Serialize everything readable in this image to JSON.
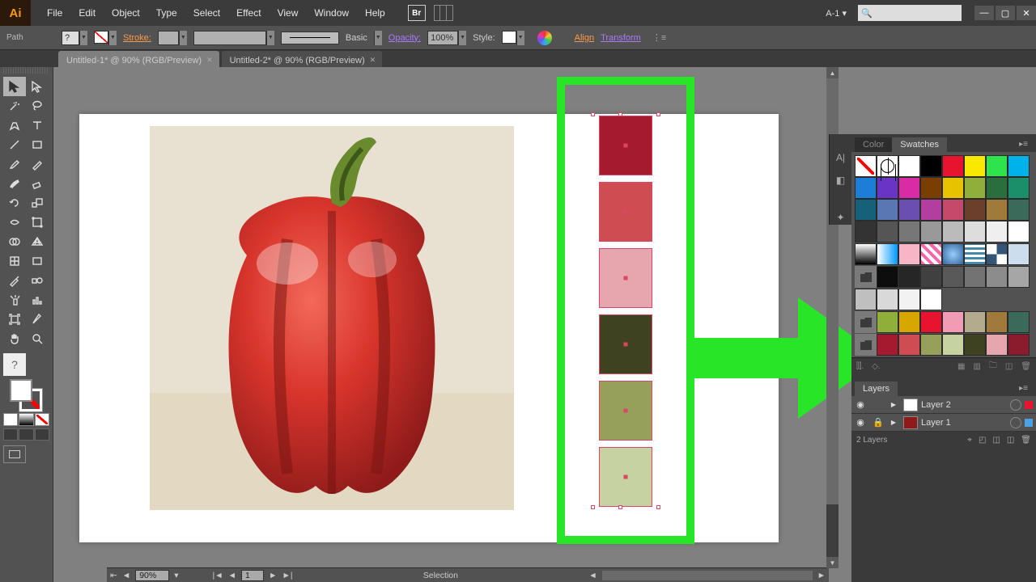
{
  "app": {
    "logo": "Ai"
  },
  "menu": [
    "File",
    "Edit",
    "Object",
    "Type",
    "Select",
    "Effect",
    "View",
    "Window",
    "Help"
  ],
  "titlebar": {
    "bridge_label": "Br",
    "workspace": "A-1",
    "search_placeholder": ""
  },
  "controlbar": {
    "type": "Path",
    "stroke_label": "Stroke:",
    "profile_label": "Basic",
    "opacity_label": "Opacity:",
    "opacity_value": "100%",
    "style_label": "Style:",
    "align_label": "Align",
    "transform_label": "Transform"
  },
  "tabs": [
    {
      "label": "Untitled-1* @ 90% (RGB/Preview)",
      "active": true
    },
    {
      "label": "Untitled-2* @ 90% (RGB/Preview)",
      "active": false
    }
  ],
  "color_samples": [
    "#a61a2e",
    "#cf4c53",
    "#e5a6ad",
    "#3f4220",
    "#97a05a",
    "#c6d3a0"
  ],
  "panels": {
    "color_tab": "Color",
    "swatches_tab": "Swatches",
    "swatches": [
      "none",
      "reg",
      "#ffffff",
      "#000000",
      "#e7132f",
      "#fbe800",
      "#2ee34c",
      "#00b2ea",
      "#1c7ed6",
      "#6a34c7",
      "#d92ba5",
      "#7a3f00",
      "#e6c200",
      "#8fae3a",
      "#2a6e3d",
      "#1b8f6a",
      "#14627a",
      "#5a77b4",
      "#6b4fb0",
      "#b03fa0",
      "#c44a6a",
      "#6b3f2a",
      "#a07a3a",
      "#3a6b5a",
      "#333333",
      "#555555",
      "#777777",
      "#999999",
      "#bbbbbb",
      "#dddddd",
      "#efefef",
      "#ffffff"
    ],
    "gray_row": [
      "#8a8a8a",
      "#0d0d0d",
      "#262626",
      "#404040",
      "#595959",
      "#737373",
      "#8c8c8c",
      "#a6a6a6"
    ],
    "light_row": [
      "#bfbfbf",
      "#d9d9d9",
      "#f2f2f2",
      "#ffffff"
    ],
    "group_row": [
      "#5fb7d4",
      "#8fae3a",
      "#d7a700",
      "#e7132f",
      "#f29bb4",
      "#b4aa8c",
      "#a07a3a",
      "#3a6b5a"
    ],
    "pepper_row": [
      "#a51a2e",
      "#cf4c53",
      "#97a05a",
      "#c6d3a0",
      "#3f4220",
      "#e5a6ad",
      "#8b1c2e"
    ],
    "layers_tab": "Layers",
    "layer_names": [
      "Layer 2",
      "Layer 1"
    ],
    "layers_footer": "2 Layers"
  },
  "status": {
    "zoom": "90%",
    "page": "1",
    "tool": "Selection"
  }
}
